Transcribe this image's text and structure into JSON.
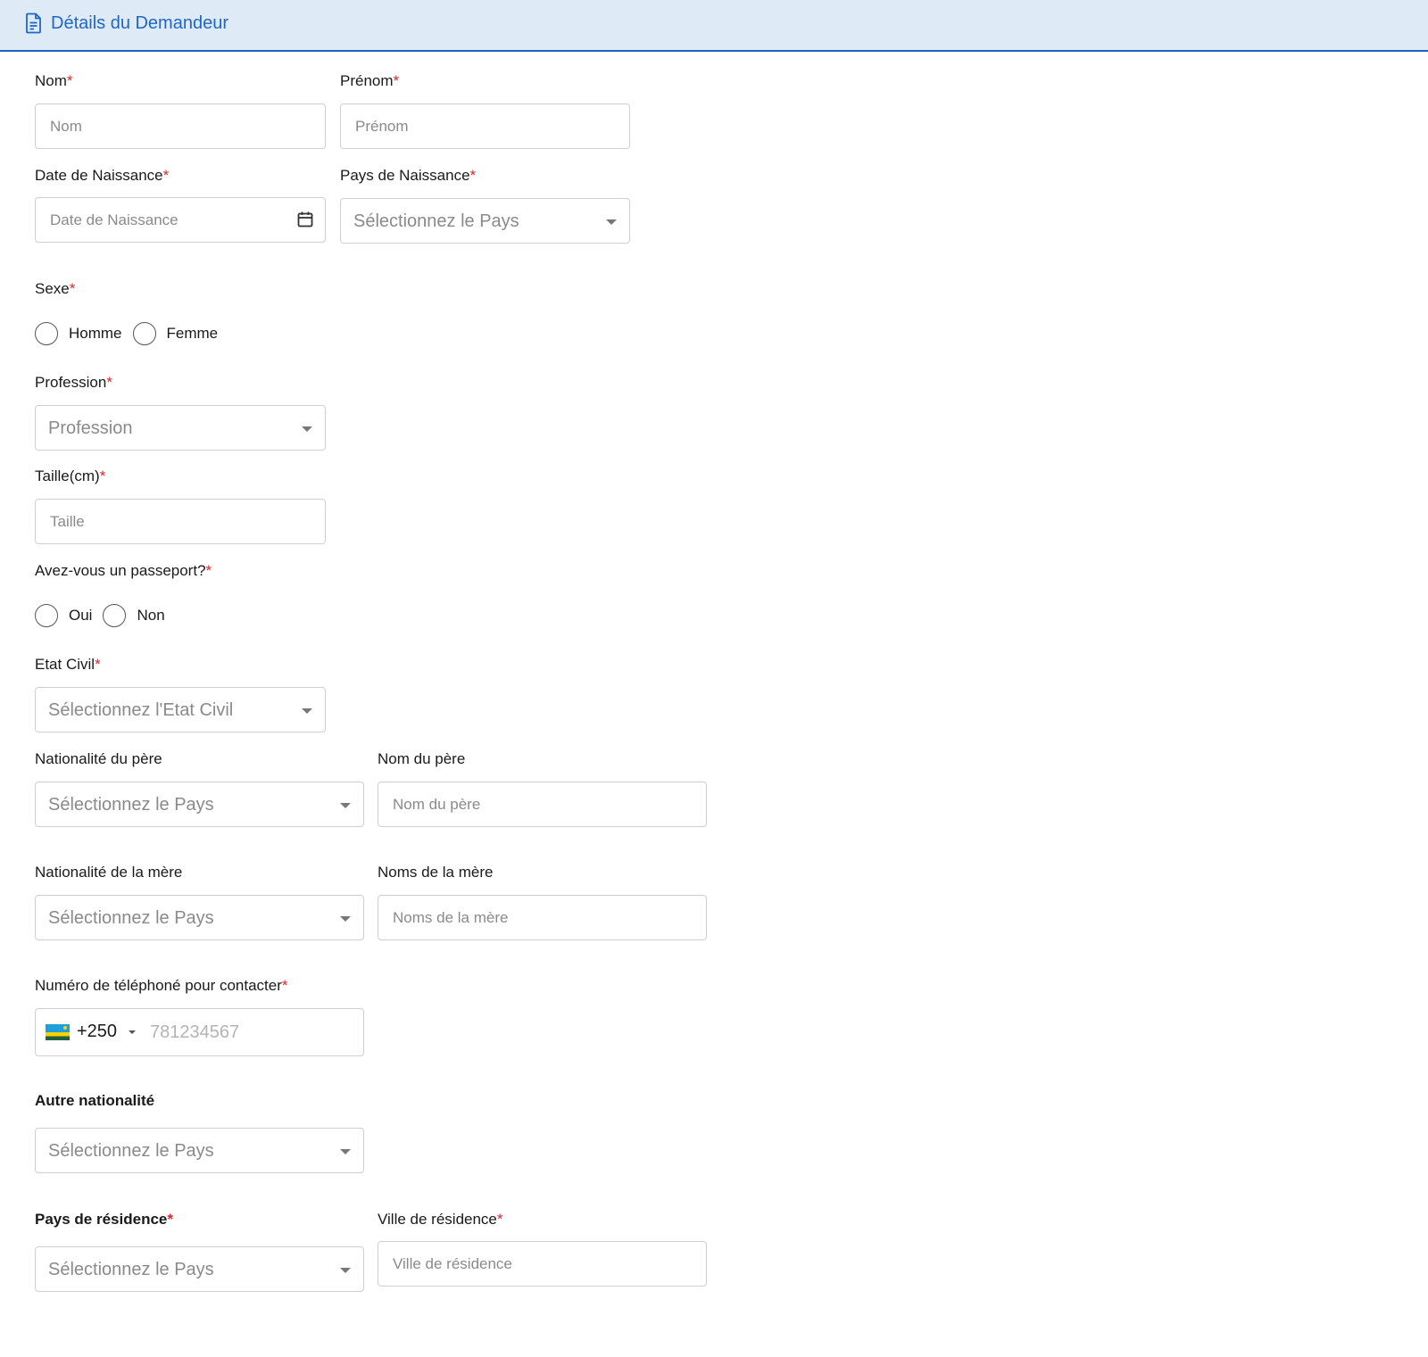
{
  "header": {
    "title": "Détails du Demandeur",
    "icon": "document-icon",
    "accent_color": "#1f66c9"
  },
  "required_mark": "*",
  "form": {
    "nom": {
      "label": "Nom",
      "placeholder": "Nom"
    },
    "prenom": {
      "label": "Prénom",
      "placeholder": "Prénom"
    },
    "date_naissance": {
      "label": "Date de Naissance",
      "placeholder": "Date de Naissance"
    },
    "pays_naissance": {
      "label": "Pays de Naissance",
      "placeholder": "Sélectionnez le Pays"
    },
    "sexe": {
      "label": "Sexe",
      "options": [
        "Homme",
        "Femme"
      ]
    },
    "profession": {
      "label": "Profession",
      "placeholder": "Profession"
    },
    "taille": {
      "label": "Taille(cm)",
      "placeholder": "Taille"
    },
    "passeport": {
      "label": "Avez-vous un passeport?",
      "options": [
        "Oui",
        "Non"
      ]
    },
    "etat_civil": {
      "label": "Etat Civil",
      "placeholder": "Sélectionnez l'Etat Civil"
    },
    "nationalite_pere": {
      "label": "Nationalité du père",
      "placeholder": "Sélectionnez le Pays"
    },
    "nom_pere": {
      "label": "Nom du père",
      "placeholder": "Nom du père"
    },
    "nationalite_mere": {
      "label": "Nationalité de la mère",
      "placeholder": "Sélectionnez le Pays"
    },
    "noms_mere": {
      "label": "Noms de la mère",
      "placeholder": "Noms de la mère"
    },
    "telephone": {
      "label": "Numéro de téléphoné pour contacter",
      "country_code": "+250",
      "placeholder": "781234567",
      "flag": "rwanda-flag-icon"
    },
    "autre_nationalite": {
      "label": "Autre nationalité",
      "placeholder": "Sélectionnez le Pays"
    },
    "pays_residence": {
      "label": "Pays de résidence",
      "placeholder": "Sélectionnez le Pays"
    },
    "ville_residence": {
      "label": "Ville de résidence",
      "placeholder": "Ville de résidence"
    }
  }
}
